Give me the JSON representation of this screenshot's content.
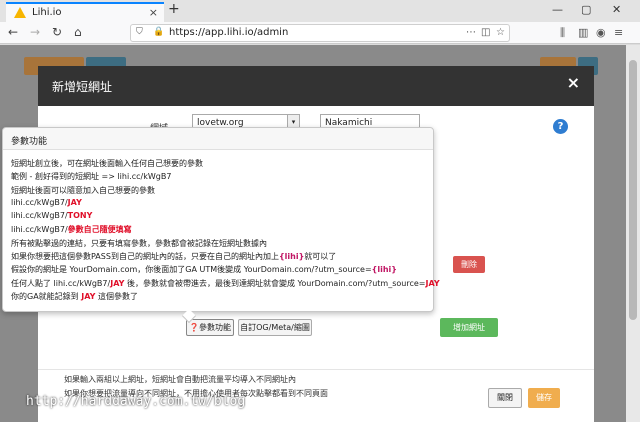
{
  "browser": {
    "tab_title": "Lihi.io",
    "tab_close": "×",
    "new_tab": "+",
    "url": "https://app.lihi.io/admin",
    "back": "←",
    "forward": "→",
    "reload": "↻",
    "home": "⌂",
    "win_min": "—",
    "win_max": "▢",
    "win_close": "✕"
  },
  "modal": {
    "title": "新增短網址",
    "close": "×",
    "field_label": "網域",
    "domain_value": "lovetw.org",
    "select_arrow": "▾",
    "text_value": "Nakamichi",
    "help": "?",
    "delete_label": "刪除",
    "add_label": "增加網址",
    "param_label": "參數功能",
    "param_icon": "❓",
    "og_label": "自訂OG/Meta/縮圖",
    "footnotes": [
      "如果輸入兩組以上網址，短網址會自動把流量平均導入不同網址內",
      "如果你想要把流量導向不同網址，不用擔心使用者每次點擊都看到不同頁面"
    ],
    "close_button": "關閉",
    "save_button": "儲存"
  },
  "popover": {
    "title": "參數功能",
    "lines": [
      [
        {
          "t": "短網址創立後，可在網址後面輸入任何自己想要的參數"
        }
      ],
      [
        {
          "t": "範例 - 創好得到的短網址 => lihi.cc/kWgB7"
        }
      ],
      [
        {
          "t": "短網址後面可以隨意加入自己想要的參數"
        }
      ],
      [
        {
          "t": "lihi.cc/kWgB7/"
        },
        {
          "t": "JAY",
          "c": "red"
        }
      ],
      [
        {
          "t": "lihi.cc/kWgB7/"
        },
        {
          "t": "TONY",
          "c": "red"
        }
      ],
      [
        {
          "t": "lihi.cc/kWgB7/"
        },
        {
          "t": "參數自己隨便填寫",
          "c": "red"
        }
      ],
      [
        {
          "t": "所有被點擊過的連結，只要有填寫參數，參數都會被記錄在短網址數據內"
        }
      ],
      [
        {
          "t": "如果你想要把這個參數PASS到自己的網址內的話，只要在自己的網址內加上"
        },
        {
          "t": "{lihi}",
          "c": "mag"
        },
        {
          "t": "就可以了"
        }
      ],
      [
        {
          "t": "假設你的網址是 YourDomain.com，你後面加了GA UTM後變成 YourDomain.com/?utm_source="
        },
        {
          "t": "{lihi}",
          "c": "mag"
        }
      ],
      [
        {
          "t": "任何人點了 lihi.cc/kWgB7/"
        },
        {
          "t": "JAY",
          "c": "red"
        },
        {
          "t": " 後，參數就會被帶進去，最後到達網址就會變成 YourDomain.com/?utm_source="
        },
        {
          "t": "JAY",
          "c": "red"
        }
      ],
      [
        {
          "t": "你的GA就能記錄到 "
        },
        {
          "t": "JAY",
          "c": "red"
        },
        {
          "t": " 這個參數了"
        }
      ]
    ]
  },
  "watermark": "http://harddaway.com.tw/blog",
  "colors": {
    "modal_header": "#333333",
    "danger": "#d9534f",
    "success": "#5cb85c",
    "warning": "#f0ad4e",
    "info": "#2f7dd1",
    "highlight_red": "#e0102a"
  }
}
